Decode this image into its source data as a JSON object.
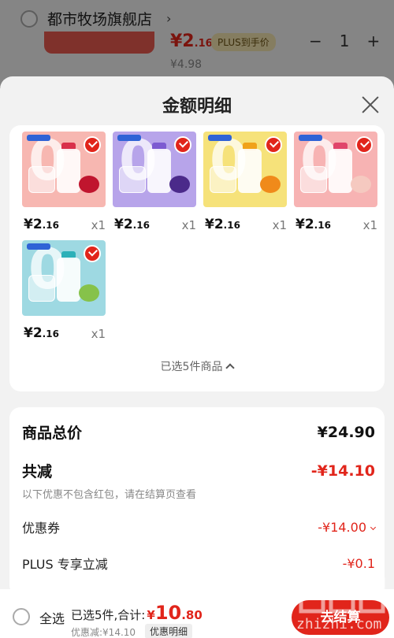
{
  "background_cart": {
    "shop_name": "都市牧场旗舰店",
    "price_main": "¥2",
    "price_decimal": ".16",
    "plus_badge": "PLUS到手价",
    "original_price": "¥4.98",
    "qty_minus": "−",
    "qty_value": "1",
    "qty_plus": "+"
  },
  "sheet": {
    "title": "金额明细",
    "products": [
      {
        "price_main": "¥2",
        "price_decimal": ".16",
        "qty": "x1",
        "bg": "#f7b7b1",
        "cap": "#d9304a",
        "fruit": "#c0152e"
      },
      {
        "price_main": "¥2",
        "price_decimal": ".16",
        "qty": "x1",
        "bg": "#b7a4ea",
        "cap": "#7d5bd1",
        "fruit": "#4b2a8a"
      },
      {
        "price_main": "¥2",
        "price_decimal": ".16",
        "qty": "x1",
        "bg": "#f6e27a",
        "cap": "#f0a21a",
        "fruit": "#f08a1a"
      },
      {
        "price_main": "¥2",
        "price_decimal": ".16",
        "qty": "x1",
        "bg": "#f7b3b3",
        "cap": "#e0456a",
        "fruit": "#f5c9c0"
      },
      {
        "price_main": "¥2",
        "price_decimal": ".16",
        "qty": "x1",
        "bg": "#9ed9e2",
        "cap": "#2bb0b8",
        "fruit": "#86c24a"
      }
    ],
    "selected_summary": "已选5件商品",
    "summary": {
      "total_label": "商品总价",
      "total_value": "¥24.90",
      "reduce_label": "共减",
      "reduce_value": "-¥14.10",
      "note": "以下优惠不包含红包，请在结算页查看",
      "coupon_label": "优惠券",
      "coupon_value": "-¥14.00",
      "plus_label": "PLUS 专享立减",
      "plus_value": "-¥0.1"
    }
  },
  "bottom_bar": {
    "select_all": "全选",
    "selected_total_label": "已选5件,合计:",
    "total_currency": "¥",
    "total_main": "10",
    "total_decimal": ".80",
    "discount_text": "优惠减:¥14.10",
    "detail_label": "优惠明细",
    "checkout": "去结算"
  },
  "watermark": {
    "text": "zhizhi.com"
  },
  "colors": {
    "accent": "#e1251b",
    "sheet_bg": "#f2f2f2"
  }
}
